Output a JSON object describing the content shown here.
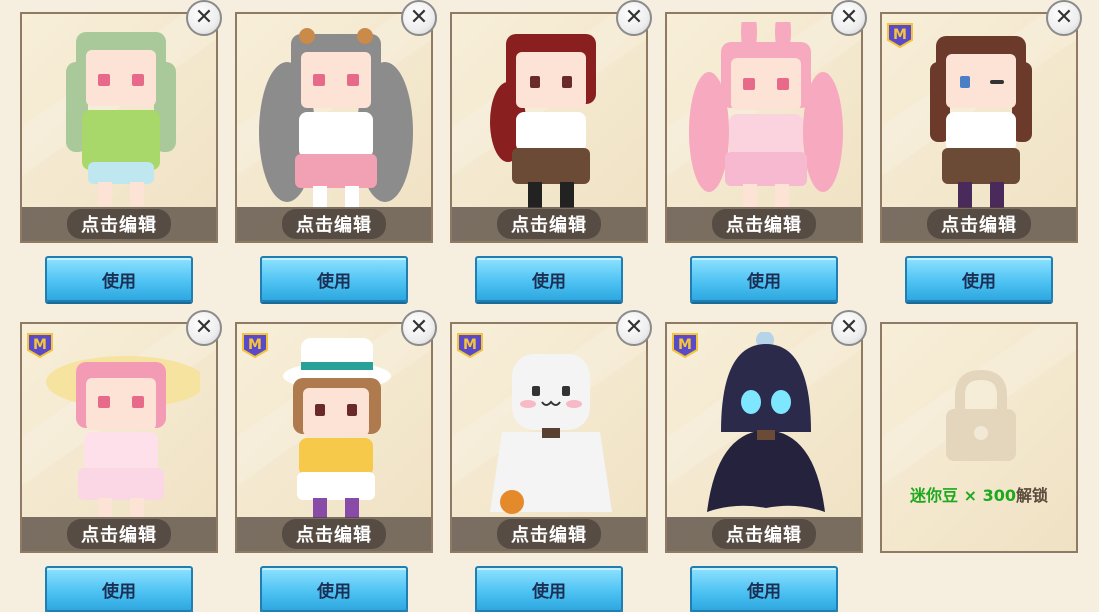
{
  "edit_label": "点击编辑",
  "use_label": "使用",
  "close_symbol": "✕",
  "badge_letter": "M",
  "lock_card": {
    "currency": "迷你豆",
    "times": "× 300",
    "action": "解锁"
  },
  "cards": [
    {
      "id": "skin-1",
      "hair": "#a9c99a",
      "outfit": "#a8d86a",
      "skirt": "#bfe7f0",
      "eyes": "#e86a8a",
      "badge": false
    },
    {
      "id": "skin-2",
      "hair": "#8c8c8c",
      "outfit": "#ffffff",
      "skirt": "#f2a0b4",
      "eyes": "#e86a8a",
      "badge": false
    },
    {
      "id": "skin-3",
      "hair": "#8a1f1f",
      "outfit": "#ffffff",
      "skirt": "#6b4a36",
      "eyes": "#6b2a2a",
      "badge": false
    },
    {
      "id": "skin-4",
      "hair": "#f7a9c0",
      "outfit": "#fbd3df",
      "skirt": "#f7b9cf",
      "eyes": "#e86a8a",
      "badge": false
    },
    {
      "id": "skin-5",
      "hair": "#6b3a2a",
      "outfit": "#ffffff",
      "skirt": "#6b4a36",
      "eyes": "#4a7fc8",
      "badge": true
    },
    {
      "id": "skin-6",
      "hair": "#f39bb5",
      "outfit": "#fde0ea",
      "skirt": "#fbd6e4",
      "eyes": "#e86a8a",
      "badge": true
    },
    {
      "id": "skin-7",
      "hair": "#b07a4f",
      "outfit": "#f7c94a",
      "skirt": "#ffffff",
      "eyes": "#6b2a2a",
      "badge": true
    },
    {
      "id": "skin-8",
      "hair": "#f4f4f4",
      "outfit": "#f4f4f4",
      "skirt": "#e6e6e6",
      "eyes": "#333333",
      "badge": true
    },
    {
      "id": "skin-9",
      "hair": "#2c2a4a",
      "outfit": "#2c2a4a",
      "skirt": "#24223d",
      "eyes": "#7fe6ff",
      "badge": true
    }
  ]
}
